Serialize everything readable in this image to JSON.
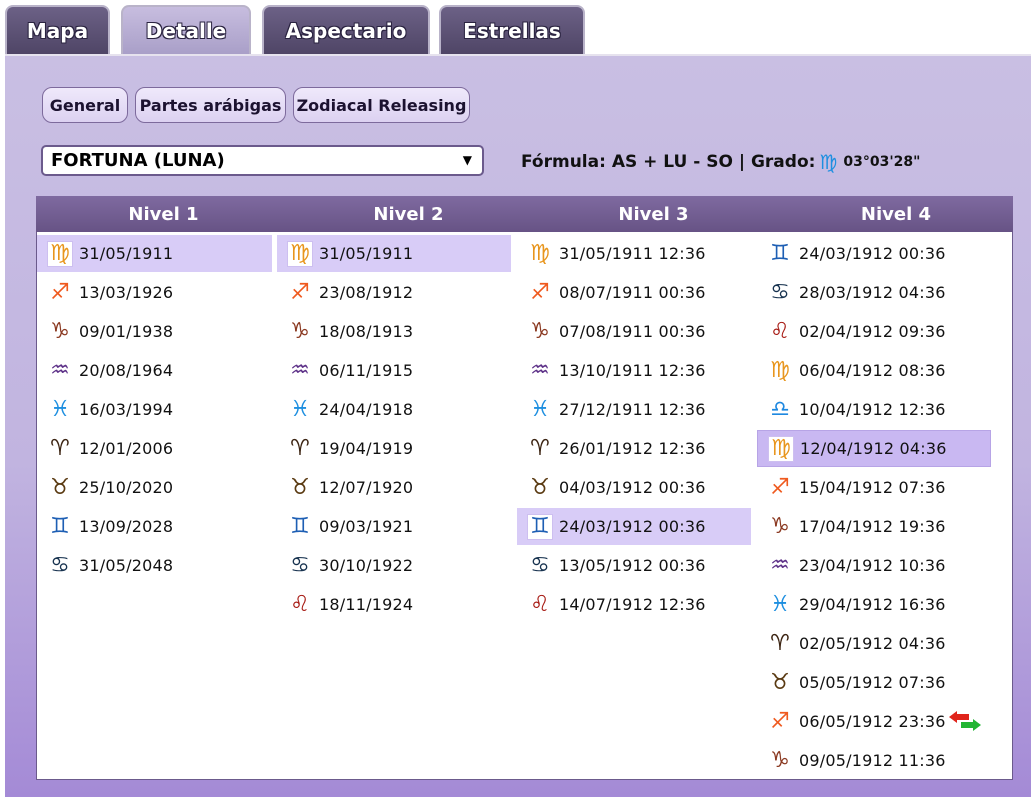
{
  "tabs": [
    {
      "label": "Mapa"
    },
    {
      "label": "Detalle"
    },
    {
      "label": "Aspectario"
    },
    {
      "label": "Estrellas"
    }
  ],
  "subtabs": [
    {
      "label": "General"
    },
    {
      "label": "Partes arábigas"
    },
    {
      "label": "Zodiacal Releasing"
    }
  ],
  "select": {
    "value": "FORTUNA (LUNA)"
  },
  "formula": {
    "label": "Fórmula: AS + LU - SO | Grado:",
    "degree": "03°03'28\""
  },
  "columns": [
    {
      "header": "Nivel 1"
    },
    {
      "header": "Nivel 2"
    },
    {
      "header": "Nivel 3"
    },
    {
      "header": "Nivel 4"
    }
  ],
  "colors": {
    "virgo": "#e8961e",
    "sagittarius": "#ef5a1f",
    "capricorn": "#8b3a22",
    "aquarius": "#5c2f87",
    "pisces": "#1e8fe0",
    "aries": "#3c2412",
    "taurus": "#5a3a12",
    "gemini": "#1e5fb4",
    "cancer": "#17324f",
    "leo": "#a81d16",
    "libra": "#1e88e0"
  },
  "levels": [
    {
      "rows": [
        {
          "sign": "virgo",
          "date": "31/05/1911"
        },
        {
          "sign": "sagittarius",
          "date": "13/03/1926"
        },
        {
          "sign": "capricorn",
          "date": "09/01/1938"
        },
        {
          "sign": "aquarius",
          "date": "20/08/1964"
        },
        {
          "sign": "pisces",
          "date": "16/03/1994"
        },
        {
          "sign": "aries",
          "date": "12/01/2006"
        },
        {
          "sign": "taurus",
          "date": "25/10/2020"
        },
        {
          "sign": "gemini",
          "date": "13/09/2028"
        },
        {
          "sign": "cancer",
          "date": "31/05/2048"
        }
      ]
    },
    {
      "rows": [
        {
          "sign": "virgo",
          "date": "31/05/1911"
        },
        {
          "sign": "sagittarius",
          "date": "23/08/1912"
        },
        {
          "sign": "capricorn",
          "date": "18/08/1913"
        },
        {
          "sign": "aquarius",
          "date": "06/11/1915"
        },
        {
          "sign": "pisces",
          "date": "24/04/1918"
        },
        {
          "sign": "aries",
          "date": "19/04/1919"
        },
        {
          "sign": "taurus",
          "date": "12/07/1920"
        },
        {
          "sign": "gemini",
          "date": "09/03/1921"
        },
        {
          "sign": "cancer",
          "date": "30/10/1922"
        },
        {
          "sign": "leo",
          "date": "18/11/1924"
        }
      ]
    },
    {
      "rows": [
        {
          "sign": "virgo",
          "date": "31/05/1911 12:36"
        },
        {
          "sign": "sagittarius",
          "date": "08/07/1911 00:36"
        },
        {
          "sign": "capricorn",
          "date": "07/08/1911 00:36"
        },
        {
          "sign": "aquarius",
          "date": "13/10/1911 12:36"
        },
        {
          "sign": "pisces",
          "date": "27/12/1911 12:36"
        },
        {
          "sign": "aries",
          "date": "26/01/1912 12:36"
        },
        {
          "sign": "taurus",
          "date": "04/03/1912 00:36"
        },
        {
          "sign": "gemini",
          "date": "24/03/1912 00:36"
        },
        {
          "sign": "cancer",
          "date": "13/05/1912 00:36"
        },
        {
          "sign": "leo",
          "date": "14/07/1912 12:36"
        }
      ]
    },
    {
      "rows": [
        {
          "sign": "gemini",
          "date": "24/03/1912 00:36"
        },
        {
          "sign": "cancer",
          "date": "28/03/1912 04:36"
        },
        {
          "sign": "leo",
          "date": "02/04/1912 09:36"
        },
        {
          "sign": "virgo",
          "date": "06/04/1912 08:36"
        },
        {
          "sign": "libra",
          "date": "10/04/1912 12:36"
        },
        {
          "sign": "virgo",
          "date": "12/04/1912 04:36"
        },
        {
          "sign": "sagittarius",
          "date": "15/04/1912 07:36"
        },
        {
          "sign": "capricorn",
          "date": "17/04/1912 19:36"
        },
        {
          "sign": "aquarius",
          "date": "23/04/1912 10:36"
        },
        {
          "sign": "pisces",
          "date": "29/04/1912 16:36"
        },
        {
          "sign": "aries",
          "date": "02/05/1912 04:36"
        },
        {
          "sign": "taurus",
          "date": "05/05/1912 07:36"
        },
        {
          "sign": "sagittarius",
          "date": "06/05/1912 23:36"
        },
        {
          "sign": "capricorn",
          "date": "09/05/1912 11:36"
        }
      ]
    }
  ]
}
